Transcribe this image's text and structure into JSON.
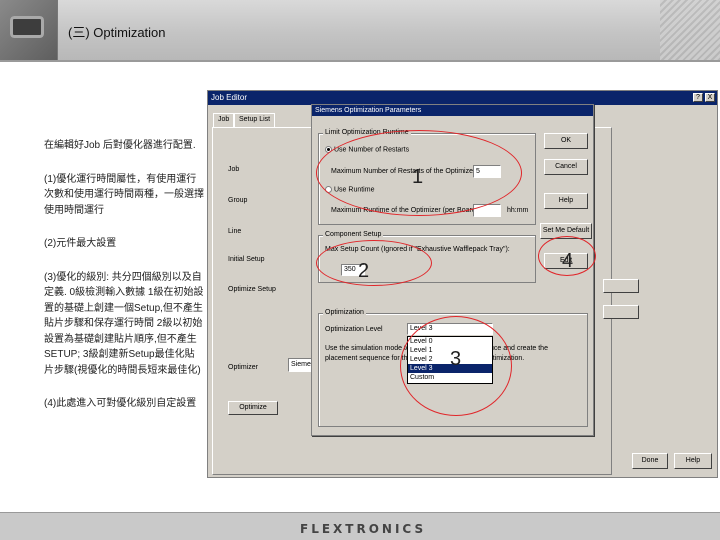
{
  "header": {
    "title": "(三) Optimization"
  },
  "notes": [
    "在編輯好Job 后對優化器進行配置.",
    "(1)優化運行時間屬性，有使用運行次數和使用運行時間兩種，一般選擇使用時間運行",
    "(2)元件最大設置",
    "(3)優化的級別: 共分四個級別以及自定義. 0級檢測輸入數據 1級在初始設置的基礎上創建一個Setup,但不產生貼片步驟和保存運行時間 2級以初始設置為基礎創建貼片順序,但不產生SETUP; 3級創建新Setup最佳化貼片步驟(視優化的時間長短來最佳化)",
    "(4)此處進入可對優化級別自定設置"
  ],
  "job_editor": {
    "title": "Job Editor",
    "title_buttons": [
      "?",
      "X"
    ],
    "tabs": [
      "Job",
      "Setup List"
    ],
    "labels": [
      "Job",
      "Group",
      "Line",
      "Initial Setup",
      "Optimize Setup"
    ],
    "optimizer_label": "Optimizer",
    "optimizer_value": "Siemens",
    "buttons": [
      "OK",
      "Cancel",
      "Help",
      "Optimize"
    ],
    "bottom_buttons": [
      "Done",
      "Help"
    ]
  },
  "sop": {
    "title": "Siemens Optimization Parameters",
    "limit_group": "Limit Optimization Runtime",
    "radio_restarts": "Use Number of Restarts",
    "max_restarts_label": "Maximum Number of Restarts of the Optimizer",
    "max_restarts_value": "5",
    "radio_runtime": "Use Runtime",
    "max_runtime_label": "Maximum Runtime of the Optimizer (per Board)",
    "max_runtime_unit": "hh:mm",
    "component_group": "Component Setup",
    "max_setup_label": "Max Setup Count (Ignored if \"Exhaustive Wafflepack Tray\"):",
    "max_setup_value": "350",
    "optimization_group": "Optimization",
    "level_label": "Optimization Level",
    "level_value": "Level 3",
    "desc_text": "Use the simulation mode to optimize level 3 to reproduce and create the placement sequence for the setup after refining the optimization.",
    "level_options": [
      "Level 0",
      "Level 1",
      "Level 2",
      "Level 3",
      "Custom"
    ],
    "level_selected_index": 3,
    "buttons": [
      "OK",
      "Cancel",
      "Help",
      "Set Me Default",
      "Edit"
    ]
  },
  "annotations": [
    "1",
    "2",
    "3",
    "4"
  ],
  "footer": {
    "logo": "FLEXTRONICS"
  }
}
